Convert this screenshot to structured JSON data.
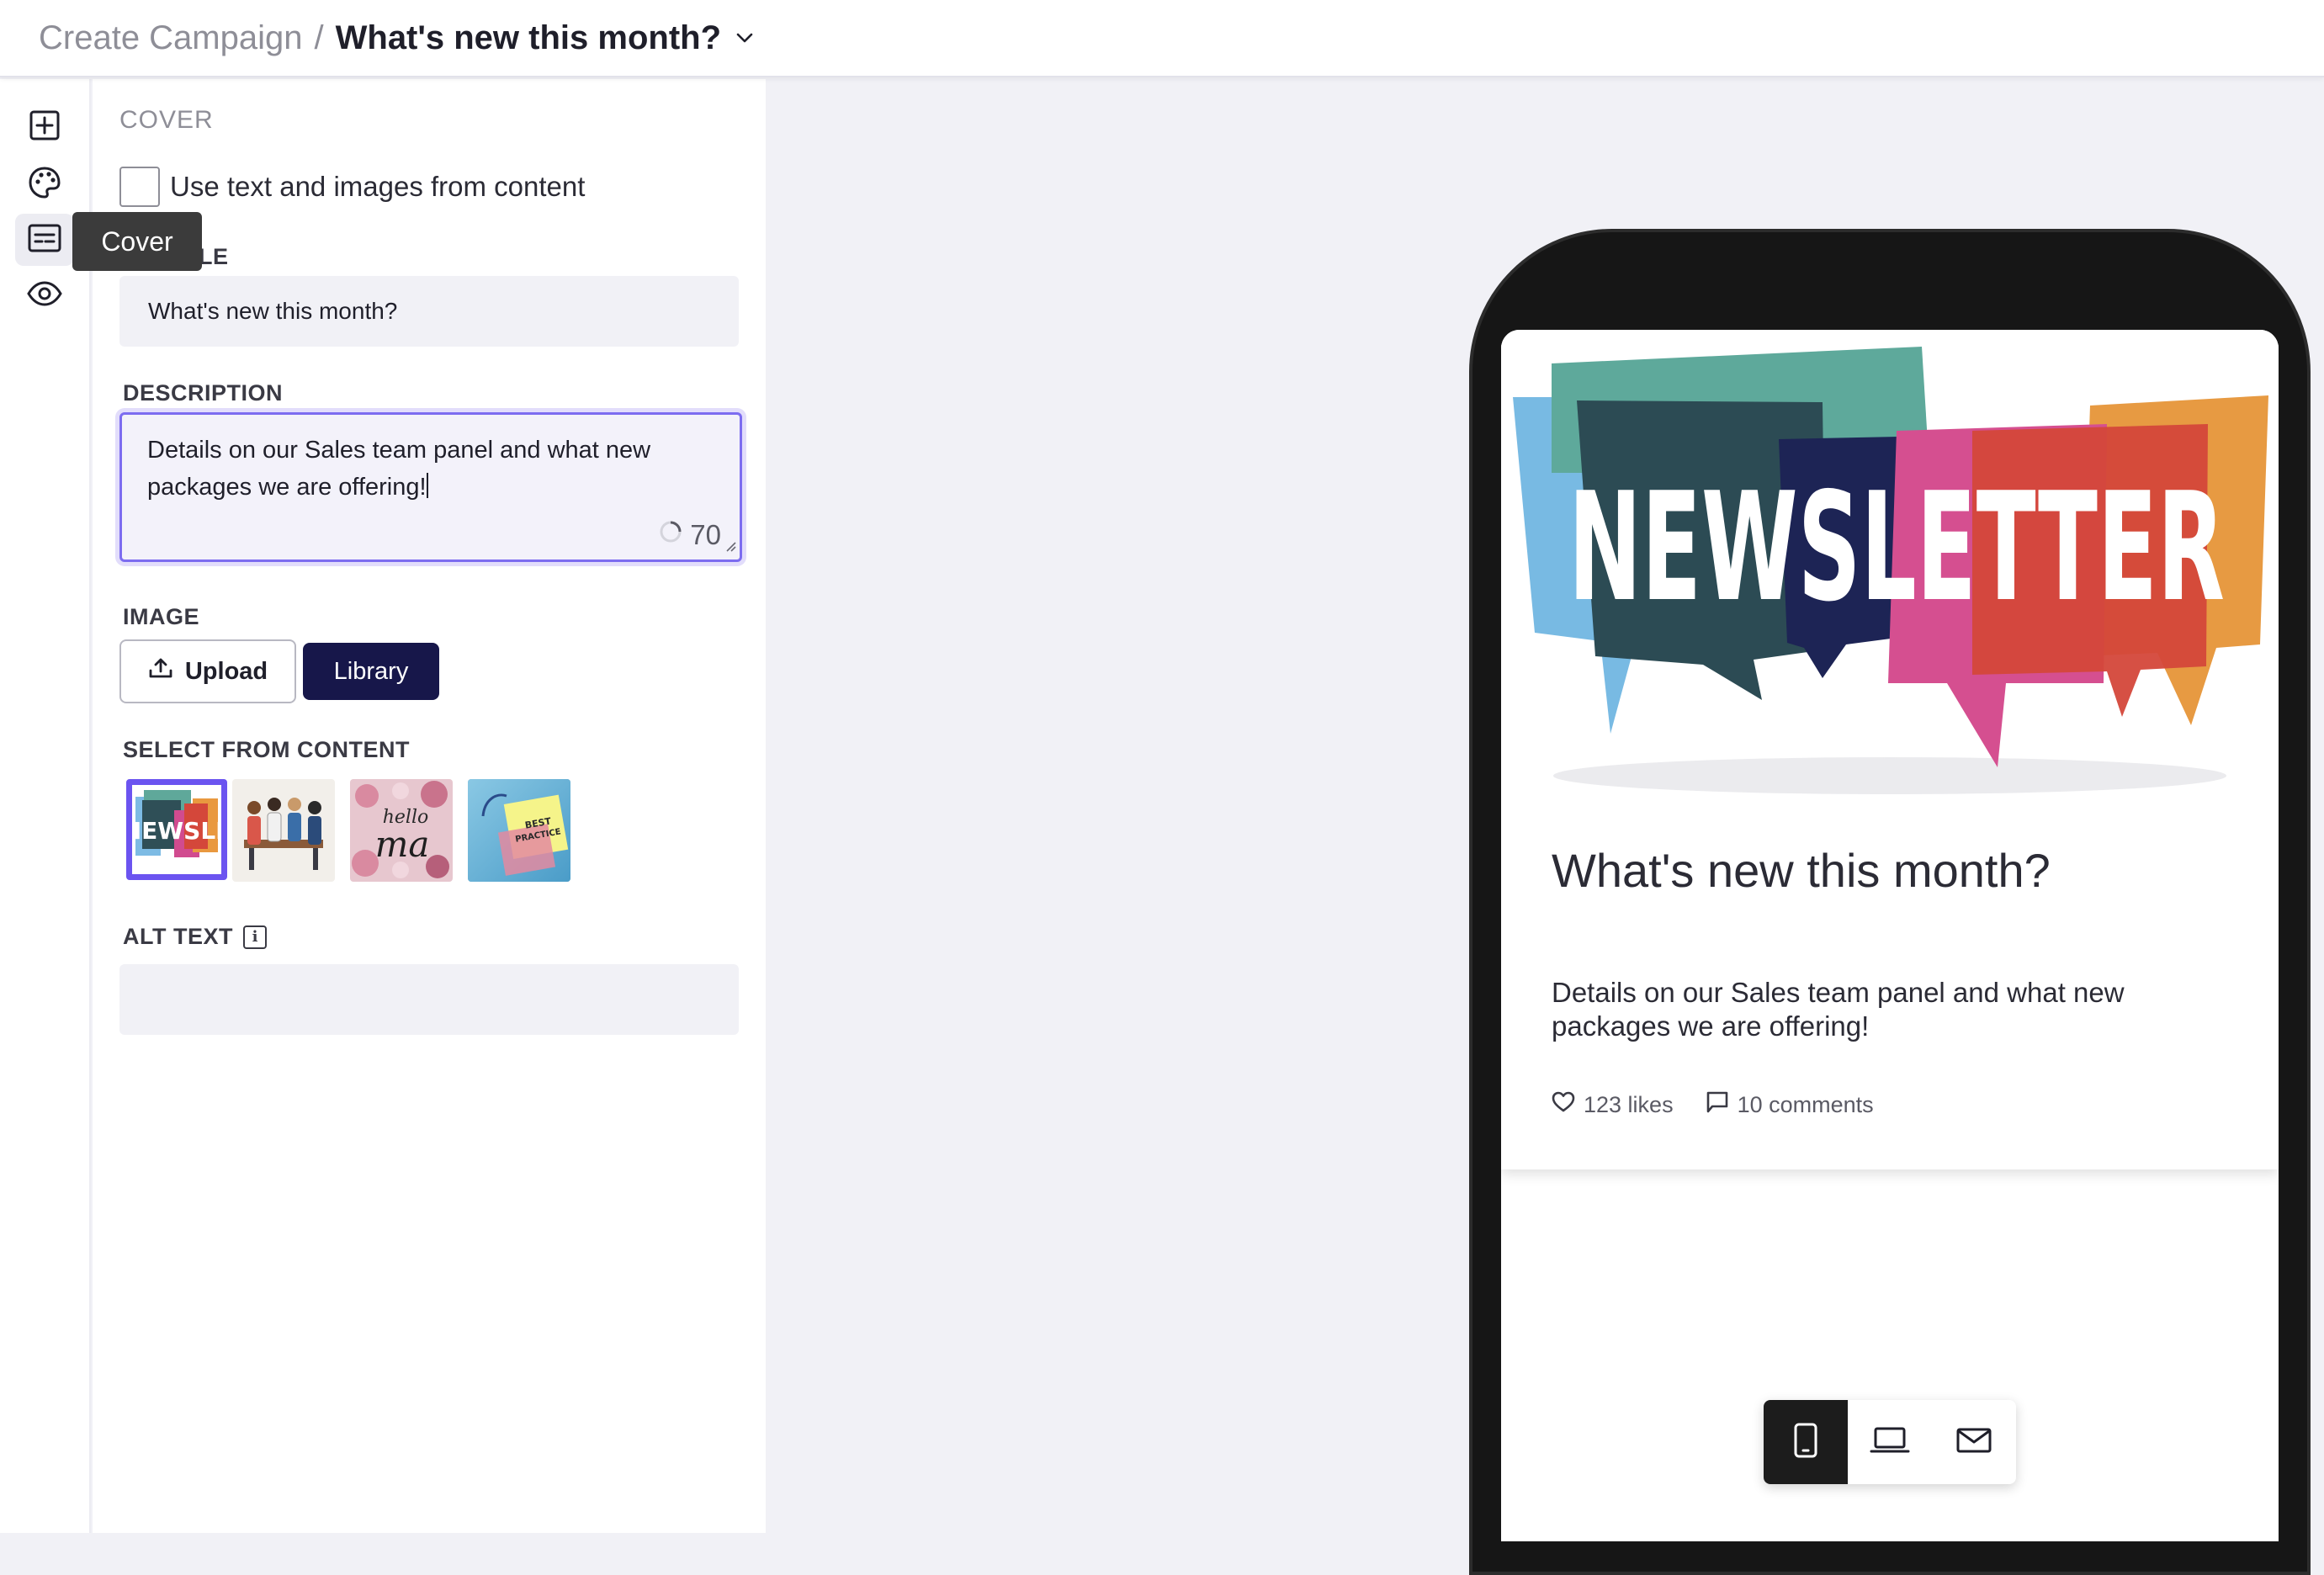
{
  "breadcrumb": {
    "parent": "Create Campaign",
    "separator": "/",
    "current": "What's new this month?"
  },
  "rail": {
    "items": [
      {
        "icon": "add-square-icon"
      },
      {
        "icon": "palette-icon"
      },
      {
        "icon": "cover-card-icon",
        "active": true
      },
      {
        "icon": "eye-icon"
      }
    ],
    "tooltip": "Cover"
  },
  "panel": {
    "section_title": "COVER",
    "use_content_label": "Use text and images from content",
    "title_label": "TITLE",
    "title_value": "What's new this month?",
    "description_label": "DESCRIPTION",
    "description_value": "Details on our Sales team panel and what new packages we are offering!",
    "char_count": "70",
    "image_label": "IMAGE",
    "upload_label": "Upload",
    "library_label": "Library",
    "select_from_content_label": "SELECT FROM CONTENT",
    "thumbnails": [
      {
        "name": "newsletter-thumbnail",
        "selected": true
      },
      {
        "name": "team-meeting-thumbnail",
        "selected": false
      },
      {
        "name": "hello-may-thumbnail",
        "selected": false
      },
      {
        "name": "best-practice-thumbnail",
        "selected": false
      }
    ],
    "alt_text_label": "ALT TEXT",
    "alt_text_value": ""
  },
  "preview": {
    "banner_word": "NEWSLETTER",
    "card_title": "What's new this month?",
    "card_description": "Details on our Sales team panel and what new packages we are offering!",
    "likes": "123 likes",
    "comments": "10 comments"
  },
  "device_switch": {
    "options": [
      "mobile-icon",
      "laptop-icon",
      "mail-icon"
    ],
    "active": "mobile-icon"
  },
  "colors": {
    "accent": "#7c6cf0",
    "library_button": "#17174a",
    "phone_frame": "#161616",
    "canvas_bg": "#f1f1f6"
  }
}
